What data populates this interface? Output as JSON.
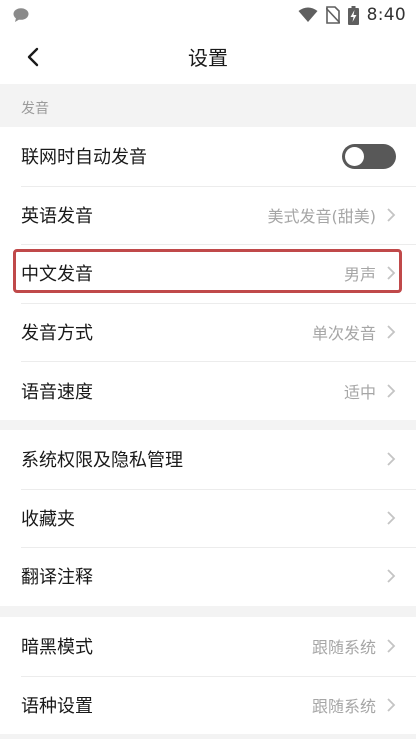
{
  "status_bar": {
    "time": "8:40"
  },
  "header": {
    "title": "设置"
  },
  "pronunciation_section": {
    "label": "发音",
    "auto_pronounce": {
      "label": "联网时自动发音",
      "enabled": false
    },
    "english": {
      "label": "英语发音",
      "value": "美式发音(甜美)"
    },
    "chinese": {
      "label": "中文发音",
      "value": "男声"
    },
    "mode": {
      "label": "发音方式",
      "value": "单次发音"
    },
    "speed": {
      "label": "语音速度",
      "value": "适中"
    }
  },
  "general_section": {
    "permissions": {
      "label": "系统权限及隐私管理"
    },
    "favorites": {
      "label": "收藏夹"
    },
    "translation_notes": {
      "label": "翻译注释"
    }
  },
  "appearance_section": {
    "dark_mode": {
      "label": "暗黑模式",
      "value": "跟随系统"
    },
    "language": {
      "label": "语种设置",
      "value": "跟随系统"
    }
  },
  "colors": {
    "highlight": "#c0494a",
    "toggle_off": "#585858"
  }
}
